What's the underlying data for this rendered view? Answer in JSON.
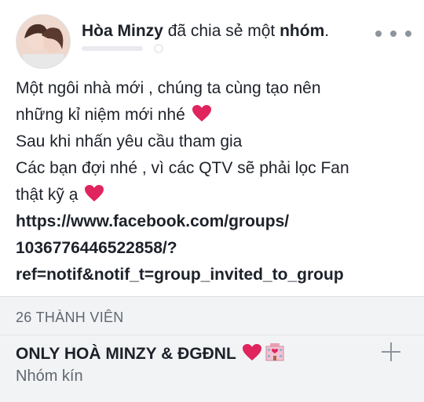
{
  "post": {
    "author": "Hòa Minzy",
    "verb": "đã chia sẻ một",
    "object": "nhóm",
    "punct": ".",
    "lines": [
      "Một ngôi nhà mới , chúng ta cùng tạo nên",
      "những kỉ niệm mới nhé",
      "Sau khi nhấn yêu cầu tham gia",
      "Các bạn đợi nhé , vì các QTV sẽ phải lọc Fan",
      "thật kỹ ạ"
    ],
    "link_lines": [
      "https://www.facebook.com/groups/",
      "1036776446522858/?",
      "ref=notif&notif_t=group_invited_to_group"
    ]
  },
  "group": {
    "members": "26 THÀNH VIÊN",
    "name": "ONLY HOÀ MINZY & ĐGĐNL",
    "type": "Nhóm kín"
  },
  "icons": {
    "heart": "red-heart-icon",
    "hotel": "love-hotel-icon",
    "more": "more-options-icon",
    "add": "plus-icon"
  },
  "colors": {
    "heart": "#e0245e",
    "card_bg": "#f2f3f5",
    "muted": "#606770"
  }
}
